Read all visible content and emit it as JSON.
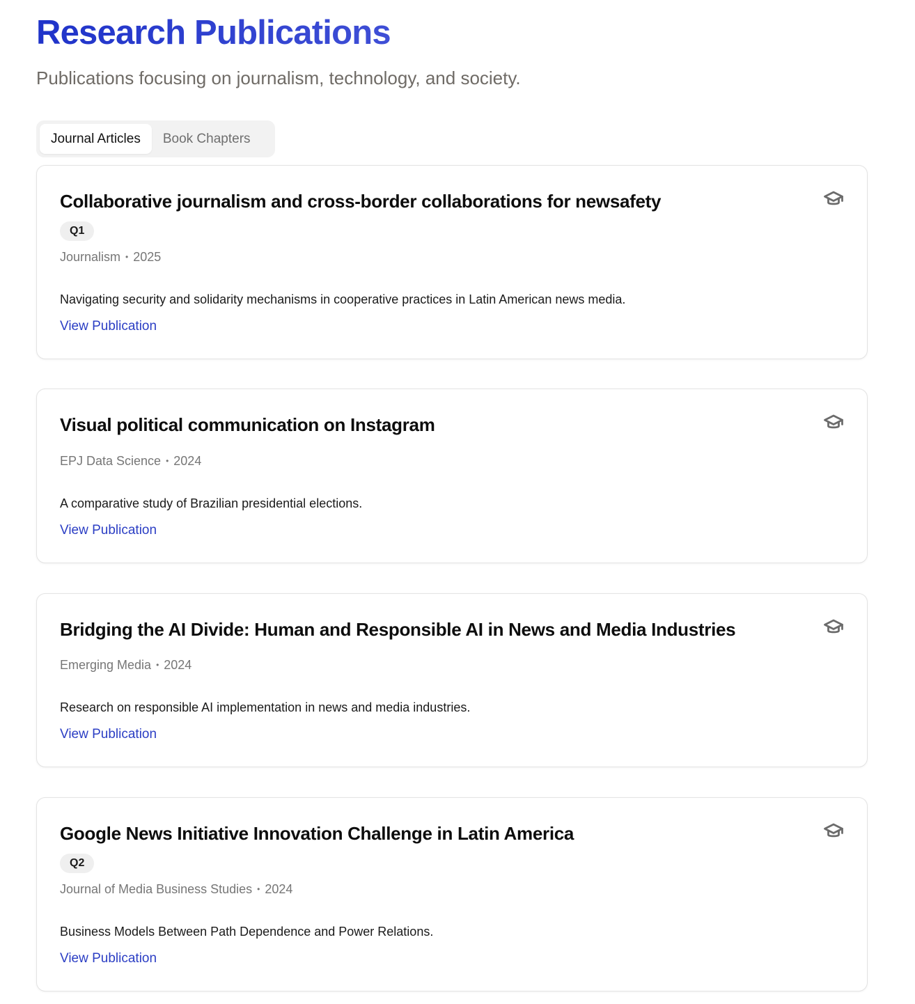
{
  "header": {
    "title": "Research Publications",
    "subtitle": "Publications focusing on journalism, technology, and society."
  },
  "tabs": [
    {
      "label": "Journal Articles",
      "active": true
    },
    {
      "label": "Book Chapters",
      "active": false
    }
  ],
  "colors": {
    "accent": "#2b3ec4",
    "title_gradient_start": "#1f33c9",
    "title_gradient_end": "#3f4fd6",
    "badge_bg": "#efefef",
    "icon": "#6b6b6b"
  },
  "publications": [
    {
      "title": "Collaborative journalism and cross-border collaborations for newsafety",
      "badge": "Q1",
      "journal": "Journalism",
      "year": "2025",
      "description": "Navigating security and solidarity mechanisms in cooperative practices in Latin American news media.",
      "link_label": "View Publication",
      "icon": "graduation-cap-icon"
    },
    {
      "title": "Visual political communication on Instagram",
      "badge": "",
      "journal": "EPJ Data Science",
      "year": "2024",
      "description": "A comparative study of Brazilian presidential elections.",
      "link_label": "View Publication",
      "icon": "graduation-cap-icon"
    },
    {
      "title": "Bridging the AI Divide: Human and Responsible AI in News and Media Industries",
      "badge": "",
      "journal": "Emerging Media",
      "year": "2024",
      "description": "Research on responsible AI implementation in news and media industries.",
      "link_label": "View Publication",
      "icon": "graduation-cap-icon"
    },
    {
      "title": "Google News Initiative Innovation Challenge in Latin America",
      "badge": "Q2",
      "journal": "Journal of Media Business Studies",
      "year": "2024",
      "description": "Business Models Between Path Dependence and Power Relations.",
      "link_label": "View Publication",
      "icon": "graduation-cap-icon"
    }
  ]
}
